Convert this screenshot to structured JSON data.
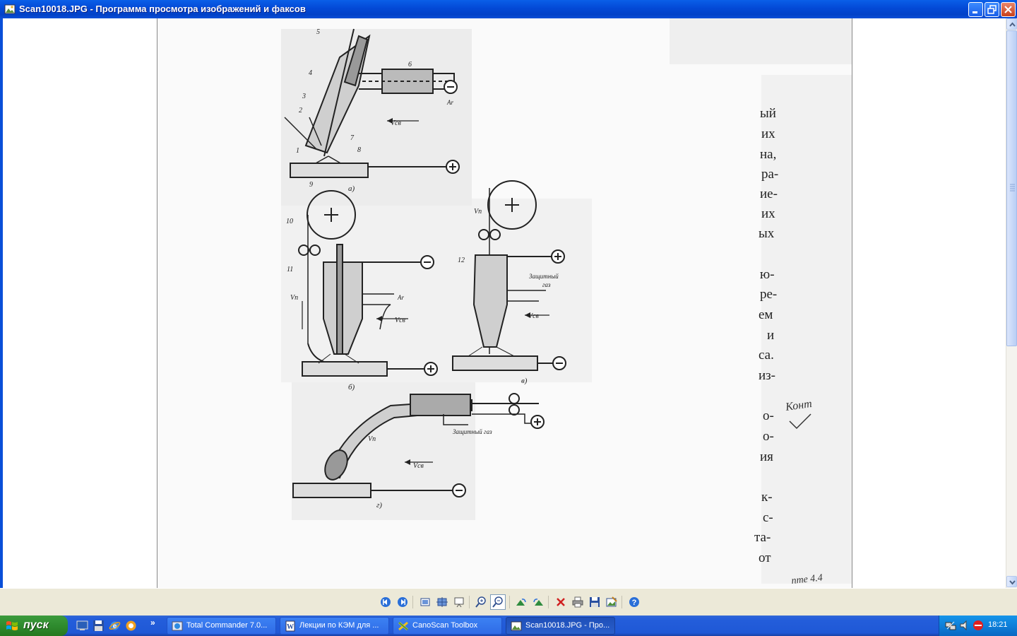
{
  "window": {
    "title": "Scan10018.JPG - Программа просмотра изображений и факсов",
    "minimize_icon": "minimize-icon",
    "maximize_icon": "restore-icon",
    "close_icon": "close-icon"
  },
  "scan": {
    "figure_labels": {
      "a": "а)",
      "b": "б)",
      "v": "в)",
      "g": "г)",
      "ar": "Ar",
      "gas": "Защитный газ",
      "gas2_line1": "Защитный",
      "gas2_line2": "газ",
      "vsv": "Vсв",
      "vp": "Vп"
    },
    "number_labels": [
      "1",
      "2",
      "3",
      "4",
      "5",
      "6",
      "7",
      "8",
      "9",
      "10",
      "11",
      "12"
    ],
    "text_fragments": [
      "ый",
      "их",
      "на,",
      "ра-",
      "ие-",
      "их",
      "ых",
      "ю-",
      "ре-",
      "ем",
      "и",
      "са.",
      "из-",
      "о-",
      "о-",
      "ия",
      "к-",
      "с-",
      "та-",
      "от"
    ],
    "handwriting_1": "Конт",
    "handwriting_2": "пте 4.4"
  },
  "toolbar": {
    "buttons": [
      {
        "name": "previous-image-button",
        "icon": "previous-icon"
      },
      {
        "name": "next-image-button",
        "icon": "next-icon"
      },
      {
        "name": "best-fit-button",
        "icon": "best-fit-icon"
      },
      {
        "name": "actual-size-button",
        "icon": "actual-size-icon"
      },
      {
        "name": "slideshow-button",
        "icon": "slideshow-icon"
      },
      {
        "name": "zoom-in-button",
        "icon": "zoom-in-icon"
      },
      {
        "name": "zoom-out-button",
        "icon": "zoom-out-icon"
      },
      {
        "name": "rotate-clockwise-button",
        "icon": "rotate-clockwise-icon"
      },
      {
        "name": "rotate-counterclockwise-button",
        "icon": "rotate-counterclockwise-icon"
      },
      {
        "name": "delete-button",
        "icon": "delete-icon"
      },
      {
        "name": "print-button",
        "icon": "print-icon"
      },
      {
        "name": "save-copy-button",
        "icon": "save-icon"
      },
      {
        "name": "edit-button",
        "icon": "edit-icon"
      },
      {
        "name": "help-button",
        "icon": "help-icon"
      }
    ]
  },
  "taskbar": {
    "start_label": "пуск",
    "quicklaunch_more": "»",
    "tasks": [
      {
        "label": "Total Commander 7.0...",
        "icon": "total-commander-icon"
      },
      {
        "label": "Лекции по КЭМ для ...",
        "icon": "document-icon"
      },
      {
        "label": "CanoScan Toolbox",
        "icon": "scanner-icon"
      },
      {
        "label": "Scan10018.JPG - Про...",
        "icon": "image-viewer-icon"
      }
    ],
    "clock": "18:21"
  },
  "colors": {
    "xp_blue": "#0349D6",
    "start_green": "#2E8B2E",
    "tray_blue": "#0E7FD9"
  }
}
